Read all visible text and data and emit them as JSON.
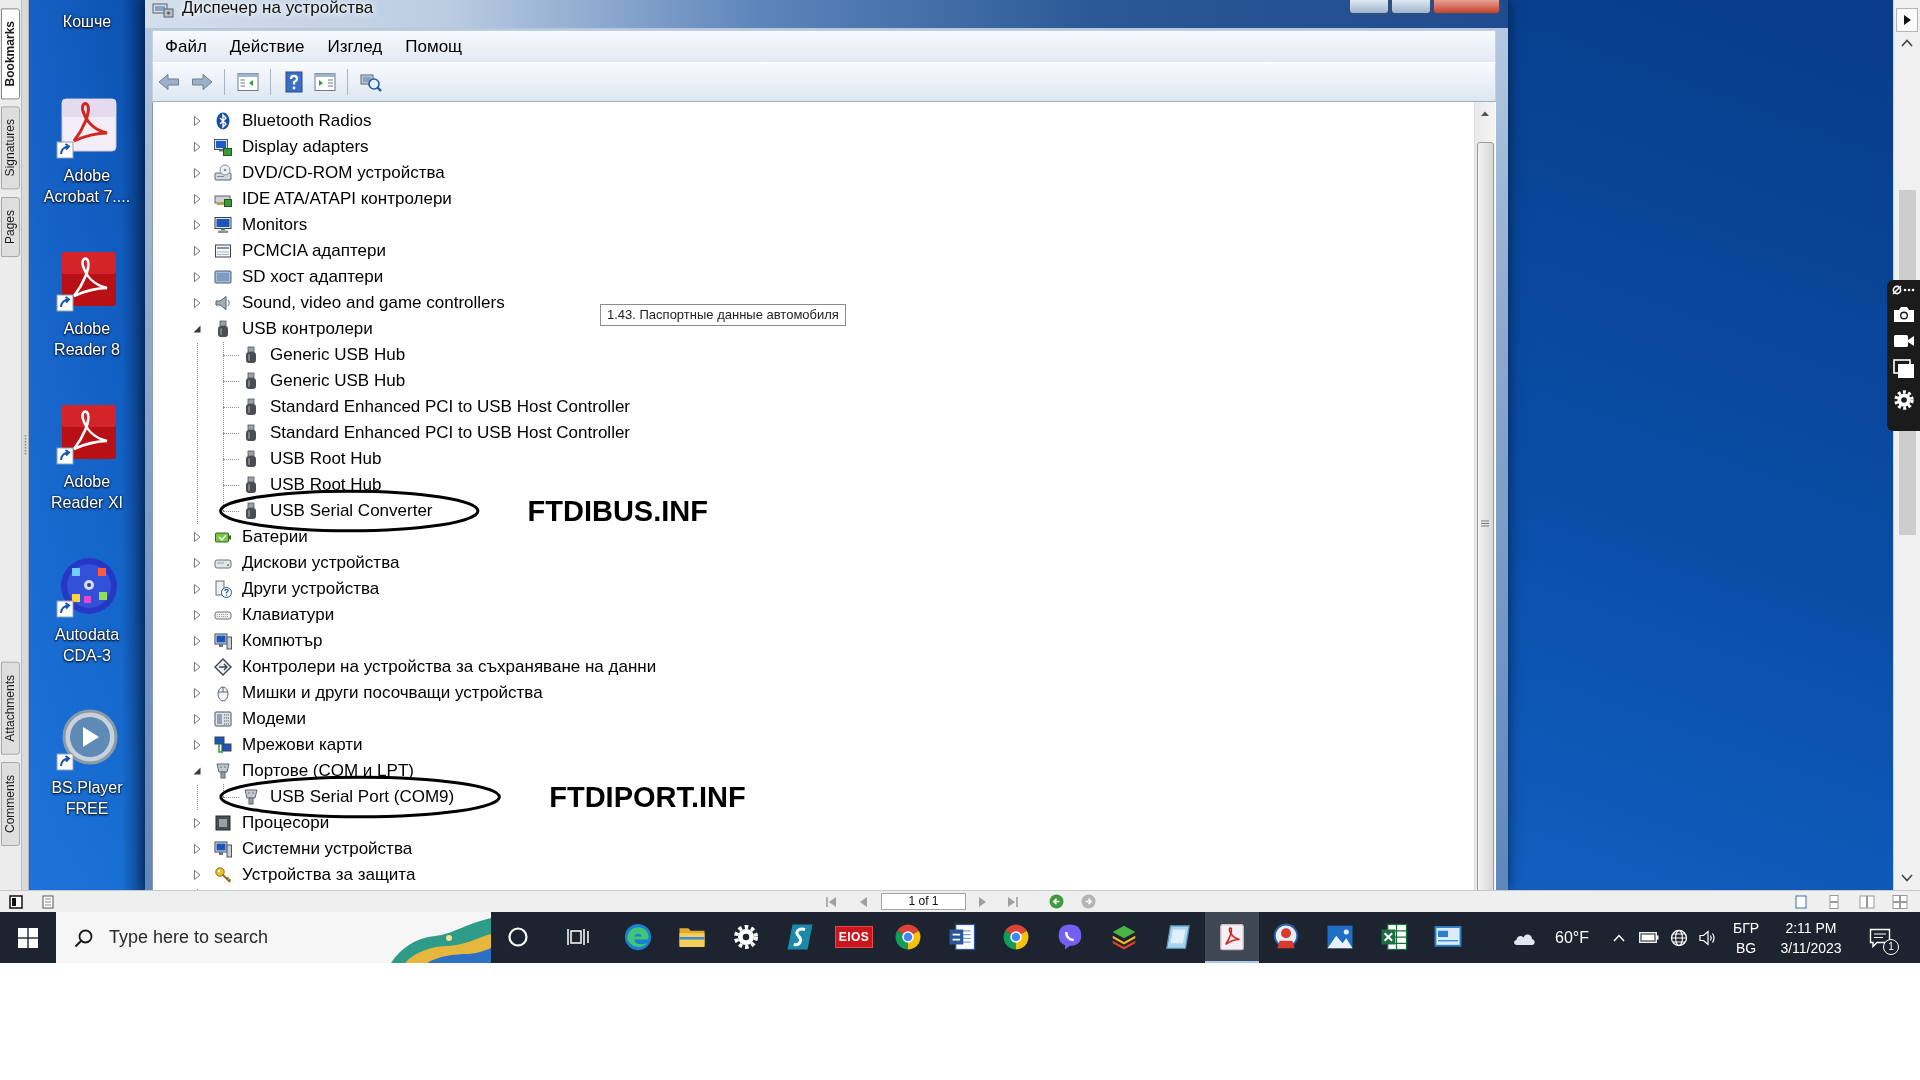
{
  "pdf_viewer": {
    "upper_tabs": [
      {
        "label": "Bookmarks",
        "selected": true
      },
      {
        "label": "Signatures",
        "selected": false
      },
      {
        "label": "Pages",
        "selected": false
      }
    ],
    "lower_tabs": [
      {
        "label": "Attachments",
        "selected": false
      },
      {
        "label": "Comments",
        "selected": false
      }
    ],
    "page_field": {
      "value": "1 of 1"
    }
  },
  "desktop": {
    "cut_off_label": "Кошче",
    "shortcuts": [
      {
        "kind": "sheet",
        "label": "Adobe\nAcrobat 7...."
      },
      {
        "kind": "pdf",
        "label": "Adobe\nReader 8"
      },
      {
        "kind": "pdf",
        "label": "Adobe\nReader XI"
      },
      {
        "kind": "disc",
        "label": "Autodata\nCDA-3"
      },
      {
        "kind": "player",
        "label": "BS.Player\nFREE"
      }
    ]
  },
  "window": {
    "title": "Диспечер на устройства",
    "menu": [
      "Файл",
      "Действие",
      "Изглед",
      "Помощ"
    ],
    "tree": [
      {
        "label": "Bluetooth Radios",
        "kind": "bluetooth",
        "expanded": false
      },
      {
        "label": "Display adapters",
        "kind": "display",
        "expanded": false
      },
      {
        "label": "DVD/CD-ROM устройства",
        "kind": "dvd",
        "expanded": false
      },
      {
        "label": "IDE ATA/ATAPI контролери",
        "kind": "ide",
        "expanded": false
      },
      {
        "label": "Monitors",
        "kind": "monitor",
        "expanded": false
      },
      {
        "label": "PCMCIA адаптери",
        "kind": "pcmcia",
        "expanded": false
      },
      {
        "label": "SD хост адаптери",
        "kind": "sd",
        "expanded": false
      },
      {
        "label": "Sound, video and game controllers",
        "kind": "sound",
        "expanded": false
      },
      {
        "label": "USB контролери",
        "kind": "usb",
        "expanded": true,
        "children": [
          {
            "label": "Generic USB Hub",
            "kind": "usb"
          },
          {
            "label": "Generic USB Hub",
            "kind": "usb"
          },
          {
            "label": "Standard Enhanced PCI to USB Host Controller",
            "kind": "usb"
          },
          {
            "label": "Standard Enhanced PCI to USB Host Controller",
            "kind": "usb"
          },
          {
            "label": "USB Root Hub",
            "kind": "usb"
          },
          {
            "label": "USB Root Hub",
            "kind": "usb"
          },
          {
            "label": "USB Serial Converter",
            "kind": "usb",
            "annotation": "FTDIBUS.INF"
          }
        ]
      },
      {
        "label": "Батерии",
        "kind": "battery",
        "expanded": false
      },
      {
        "label": "Дискови устройства",
        "kind": "disk",
        "expanded": false
      },
      {
        "label": "Други устройства",
        "kind": "unknown",
        "expanded": false
      },
      {
        "label": "Клавиатури",
        "kind": "keyboard",
        "expanded": false
      },
      {
        "label": "Компютър",
        "kind": "computer",
        "expanded": false
      },
      {
        "label": "Контролери на устройства за съхраняване на данни",
        "kind": "storage",
        "expanded": false
      },
      {
        "label": "Мишки и други посочващи устройства",
        "kind": "mouse",
        "expanded": false
      },
      {
        "label": "Модеми",
        "kind": "modem",
        "expanded": false
      },
      {
        "label": "Мрежови карти",
        "kind": "network",
        "expanded": false
      },
      {
        "label": "Портове (COM и LPT)",
        "kind": "port",
        "expanded": true,
        "children": [
          {
            "label": "USB Serial Port (COM9)",
            "kind": "port",
            "annotation": "FTDIPORT.INF"
          }
        ]
      },
      {
        "label": "Процесори",
        "kind": "processor",
        "expanded": false
      },
      {
        "label": "Системни устройства",
        "kind": "system",
        "expanded": false
      },
      {
        "label": "Устройства за защита",
        "kind": "security",
        "expanded": false
      }
    ]
  },
  "tooltip": {
    "text": "1.43. Паспортные данные автомобиля"
  },
  "taskbar": {
    "search": {
      "placeholder": "Type here to search"
    },
    "apps": [
      {
        "kind": "swirl",
        "selected": false
      },
      {
        "kind": "folder",
        "selected": false
      },
      {
        "kind": "gear",
        "selected": false
      },
      {
        "kind": "script",
        "selected": false
      },
      {
        "kind": "logo",
        "logo_text": "EIOS",
        "selected": false
      },
      {
        "kind": "browser",
        "selected": false
      },
      {
        "kind": "document",
        "selected": false
      },
      {
        "kind": "browser",
        "selected": false
      },
      {
        "kind": "chat",
        "selected": false
      },
      {
        "kind": "layers",
        "selected": false
      },
      {
        "kind": "tablet",
        "selected": false
      },
      {
        "kind": "pdf",
        "selected": true
      },
      {
        "kind": "emblem",
        "selected": false
      },
      {
        "kind": "picture",
        "selected": false
      },
      {
        "kind": "grid",
        "selected": false
      },
      {
        "kind": "screen",
        "selected": false
      }
    ],
    "weather": {
      "temperature": "60°F"
    },
    "language": {
      "code": "БГР",
      "layout": "BG"
    },
    "clock": {
      "time": "2:11 PM",
      "date": "3/11/2023"
    },
    "notifications": {
      "count": "1"
    }
  }
}
